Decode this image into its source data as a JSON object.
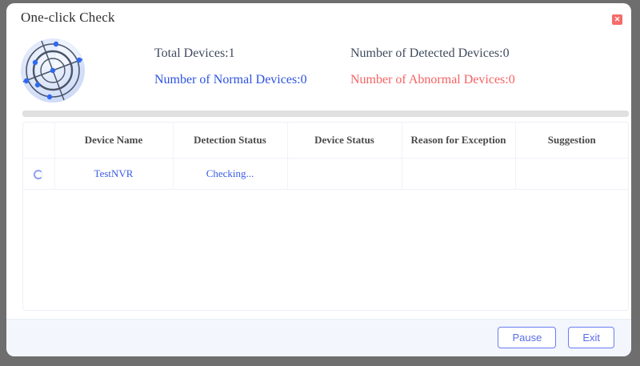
{
  "dialog": {
    "title": "One-click Check",
    "close_glyph": "✕"
  },
  "summary": {
    "total_devices": "Total Devices:1",
    "detected_devices": "Number of Detected Devices:0",
    "normal_devices": "Number of Normal Devices:0",
    "abnormal_devices": "Number of Abnormal Devices:0"
  },
  "progress": {
    "percent": 0
  },
  "table": {
    "columns": [
      "",
      "Device Name",
      "Detection Status",
      "Device Status",
      "Reason for Exception",
      "Suggestion"
    ],
    "rows": [
      {
        "device_name": "TestNVR",
        "detection_status": "Checking...",
        "device_status": "",
        "reason_for_exception": "",
        "suggestion": ""
      }
    ]
  },
  "footer": {
    "pause_label": "Pause",
    "exit_label": "Exit"
  },
  "icons": {
    "radar": "radar-icon",
    "close": "close-icon",
    "loading": "loading-spinner-icon"
  },
  "colors": {
    "accent_blue": "#2b52e0",
    "alert_red": "#f56262",
    "close_red": "#f56c6c",
    "progress_track": "#e0e0e0",
    "footer_bg": "#f3f6fc",
    "button_blue": "#5a6de8",
    "backdrop": "#6e6e6e"
  }
}
